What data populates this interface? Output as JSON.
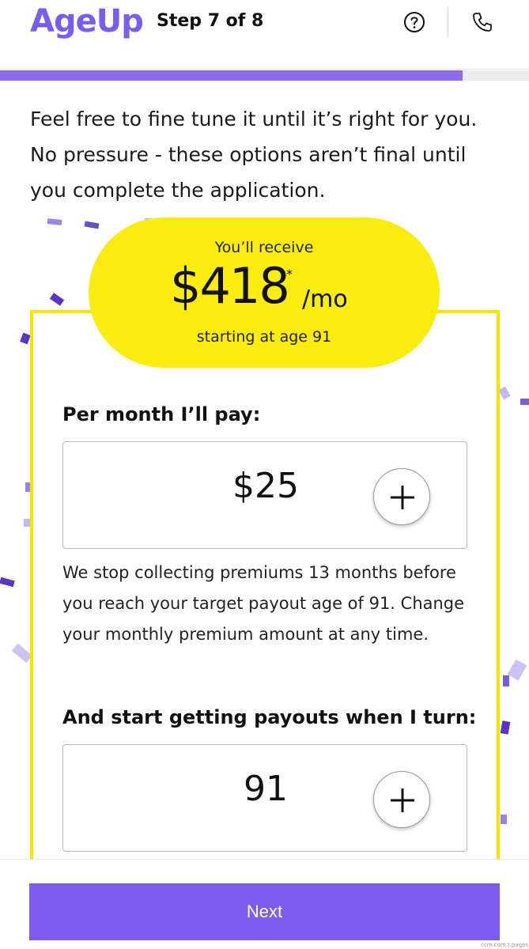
{
  "header": {
    "logo": "AgeUp",
    "step": "Step 7 of 8",
    "help_icon": "question-circle-icon",
    "phone_icon": "phone-icon"
  },
  "progress": {
    "fraction": 0.875,
    "color": "#8e6af0"
  },
  "intro": {
    "text": "Feel free to fine tune it until it’s right for you. No pressure - these options aren’t final until you complete the application."
  },
  "payout_summary": {
    "receive_label": "You’ll receive",
    "amount": "$418",
    "asterisk": "*",
    "period": "/mo",
    "starting_text": "starting at age 91"
  },
  "premium": {
    "label": "Per month I’ll pay:",
    "value": "$25",
    "increase_icon": "plus-icon",
    "note": "We stop collecting premiums 13 months before you reach your target payout age of 91. Change your monthly premium amount at any time."
  },
  "payout_age": {
    "label": "And start getting payouts when I turn:",
    "value": "91",
    "increase_icon": "plus-icon"
  },
  "footer": {
    "next_label": "Next"
  },
  "watermark": "ccm.com.t.pages",
  "colors": {
    "brand": "#7b5cf2",
    "highlight": "#f9ec0e",
    "card_border": "#f7e500",
    "button": "#7c5cf0"
  }
}
